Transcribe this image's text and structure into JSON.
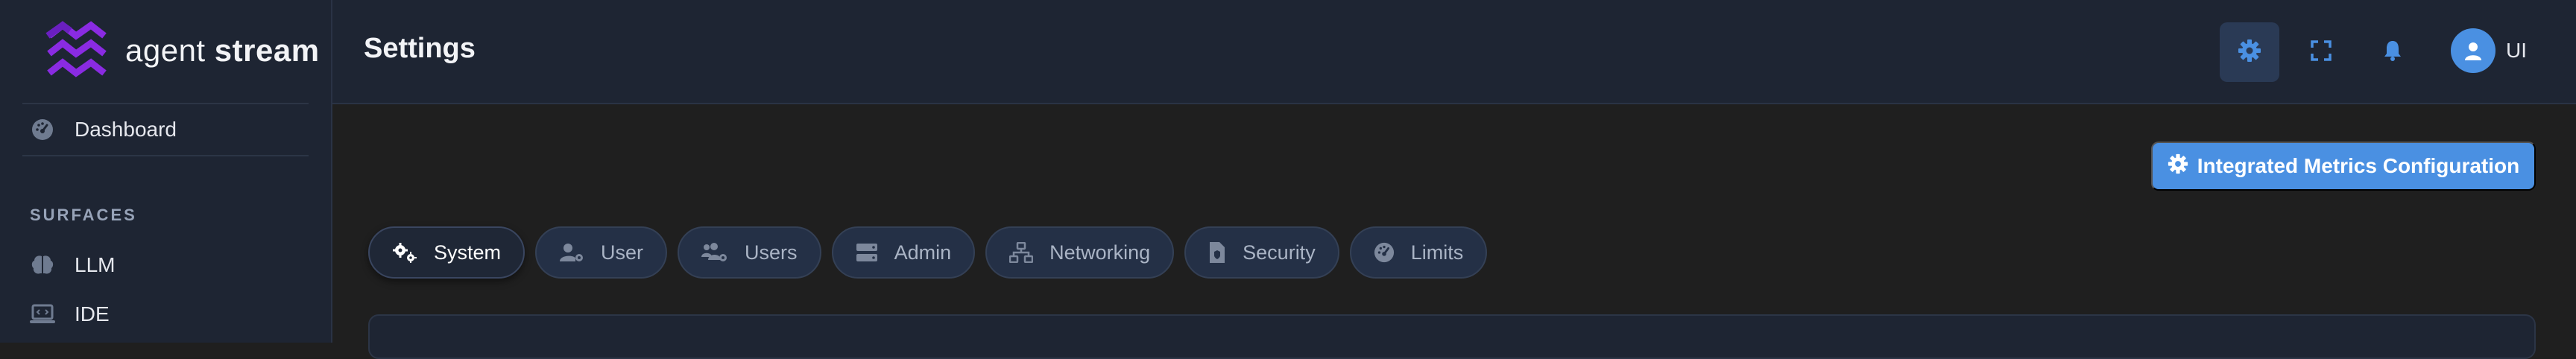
{
  "brand": {
    "name_light": "agent",
    "name_bold": "stream",
    "logo_color": "#8a2be2"
  },
  "sidebar": {
    "dashboard": {
      "label": "Dashboard",
      "icon": "gauge-icon"
    },
    "section_title": "SURFACES",
    "items": [
      {
        "label": "LLM",
        "icon": "brain-icon"
      },
      {
        "label": "IDE",
        "icon": "laptop-code-icon"
      }
    ]
  },
  "header": {
    "title": "Settings",
    "buttons": [
      {
        "icon": "gear-icon",
        "active": true
      },
      {
        "icon": "expand-icon",
        "active": false
      },
      {
        "icon": "bell-icon",
        "active": false
      }
    ],
    "user": {
      "label": "UI",
      "icon": "user-avatar-icon"
    }
  },
  "main": {
    "config_button": {
      "label": "Integrated Metrics Configuration",
      "icon": "gear-icon"
    },
    "tabs": [
      {
        "label": "System",
        "icon": "gears-icon",
        "active": true
      },
      {
        "label": "User",
        "icon": "user-gear-icon",
        "active": false
      },
      {
        "label": "Users",
        "icon": "users-gear-icon",
        "active": false
      },
      {
        "label": "Admin",
        "icon": "server-icon",
        "active": false
      },
      {
        "label": "Networking",
        "icon": "network-icon",
        "active": false
      },
      {
        "label": "Security",
        "icon": "file-shield-icon",
        "active": false
      },
      {
        "label": "Limits",
        "icon": "gauge-icon",
        "active": false
      }
    ]
  },
  "colors": {
    "accent": "#4a90e2",
    "sidebar_bg": "#1e2533",
    "content_bg": "#1f1f1f",
    "tab_bg": "#243046"
  }
}
